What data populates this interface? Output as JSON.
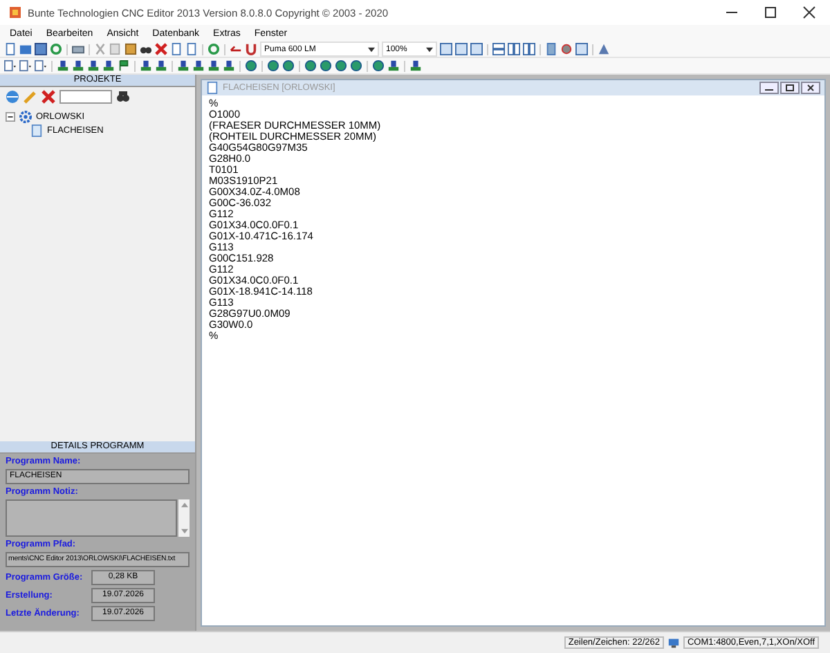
{
  "window": {
    "title": "Bunte Technologien CNC Editor 2013 Version 8.0.8.0 Copyright ©  2003 - 2020"
  },
  "menu": [
    "Datei",
    "Bearbeiten",
    "Ansicht",
    "Datenbank",
    "Extras",
    "Fenster"
  ],
  "toolbar": {
    "machine": "Puma 600 LM",
    "zoom": "100%"
  },
  "projects": {
    "title": "PROJEKTE",
    "tree": [
      {
        "label": "ORLOWSKI",
        "expanded": true,
        "children": [
          {
            "label": "FLACHEISEN"
          }
        ]
      }
    ]
  },
  "details": {
    "title": "DETAILS PROGRAMM",
    "name_label": "Programm Name:",
    "name": "FLACHEISEN",
    "note_label": "Programm Notiz:",
    "path_label": "Programm Pfad:",
    "path": "ments\\CNC Editor 2013\\ORLOWSKI\\FLACHEISEN.txt",
    "size_label": "Programm Größe:",
    "size": "0,28 KB",
    "created_label": "Erstellung:",
    "created": "19.07.2026",
    "changed_label": "Letzte Änderung:",
    "changed": "19.07.2026"
  },
  "editor": {
    "title": "FLACHEISEN [ORLOWSKI]",
    "lines": [
      "%",
      "O1000",
      "(FRAESER DURCHMESSER 10MM)",
      "(ROHTEIL DURCHMESSER 20MM)",
      "G40G54G80G97M35",
      "G28H0.0",
      "T0101",
      "M03S1910P21",
      "G00X34.0Z-4.0M08",
      "G00C-36.032",
      "G112",
      "G01X34.0C0.0F0.1",
      "G01X-10.471C-16.174",
      "G113",
      "G00C151.928",
      "G112",
      "G01X34.0C0.0F0.1",
      "G01X-18.941C-14.118",
      "G113",
      "G28G97U0.0M09",
      "G30W0.0",
      "%"
    ]
  },
  "status_bar": {
    "position": "Zeilen/Zeichen: 22/262",
    "port": "COM1:4800,Even,7,1,XOn/XOff"
  }
}
